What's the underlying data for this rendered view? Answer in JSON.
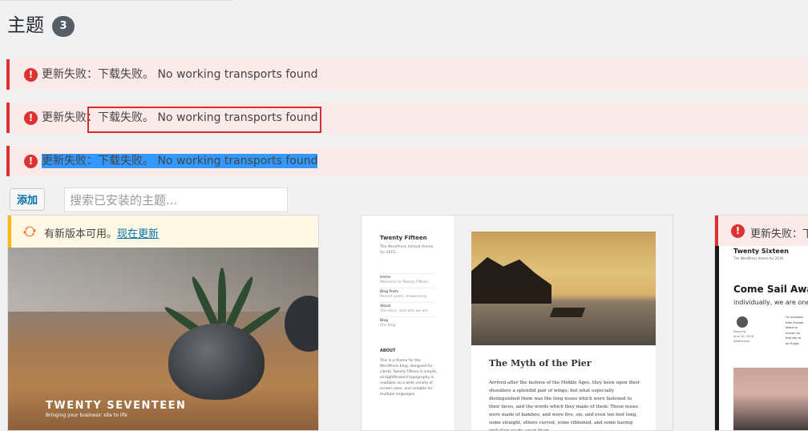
{
  "page": {
    "title": "主题",
    "count": "3"
  },
  "notices": [
    {
      "prefix": "更新失败：",
      "text": "下载失败。 No working transports found"
    },
    {
      "prefix": "更新失败：",
      "text": "下载失败。 No working transports found"
    },
    {
      "prefix": "更新失败：",
      "text": "下载失败。 No working transports found"
    }
  ],
  "toolbar": {
    "add_label": "添加",
    "search_placeholder": "搜索已安装的主题..."
  },
  "themes": [
    {
      "update_text": "有新版本可用。",
      "update_link": "现在更新",
      "screenshot_title": "TWENTY SEVENTEEN",
      "screenshot_tagline": "Bringing your business' site to life"
    },
    {
      "site_title": "Twenty Fifteen",
      "site_desc": "The WordPress default theme for 2015.",
      "nav": [
        "Home",
        "Blog Posts",
        "About",
        "Blog"
      ],
      "nav_sub": [
        "Welcome to Twenty Fifteen",
        "Recent posts, showcasing",
        "The story, and who we are",
        "Our blog"
      ],
      "about_heading": "ABOUT",
      "about_text": "This is a theme for the WordPress blog, designed for clarity. Twenty Fifteen is simple, straightforward typography is readable on a wide variety of screen sizes, and suitable for multiple languages.",
      "post_title": "The Myth of the Pier",
      "post_body": "Arrived after the fashion of the Middle Ages, they been upon their shoulders a splendid pair of wings; but what especially distinguished them was the long noses which were fastened to their faces, and the words which they made of them. These noses were made of bamboo, and were five, six, and even ten feet long, some straight, others curved, some ribboned, and some having imitation warts upon them."
    },
    {
      "notice_text": "更新失败：下",
      "site_title": "Twenty Sixteen",
      "site_desc": "The WordPress theme for 2016",
      "heading": "Come Sail Away",
      "subheading": "individually, we are one drop",
      "meta": "Swaying\nJune 10, 2016\nAdventures",
      "column": "On occasion\nfrom Europe\nshore to\nhuman sa\nthat the te\nfor Englis"
    }
  ],
  "colors": {
    "error": "#dc3232",
    "warning": "#ffb900",
    "link": "#0073aa",
    "selection": "#3399ff"
  }
}
